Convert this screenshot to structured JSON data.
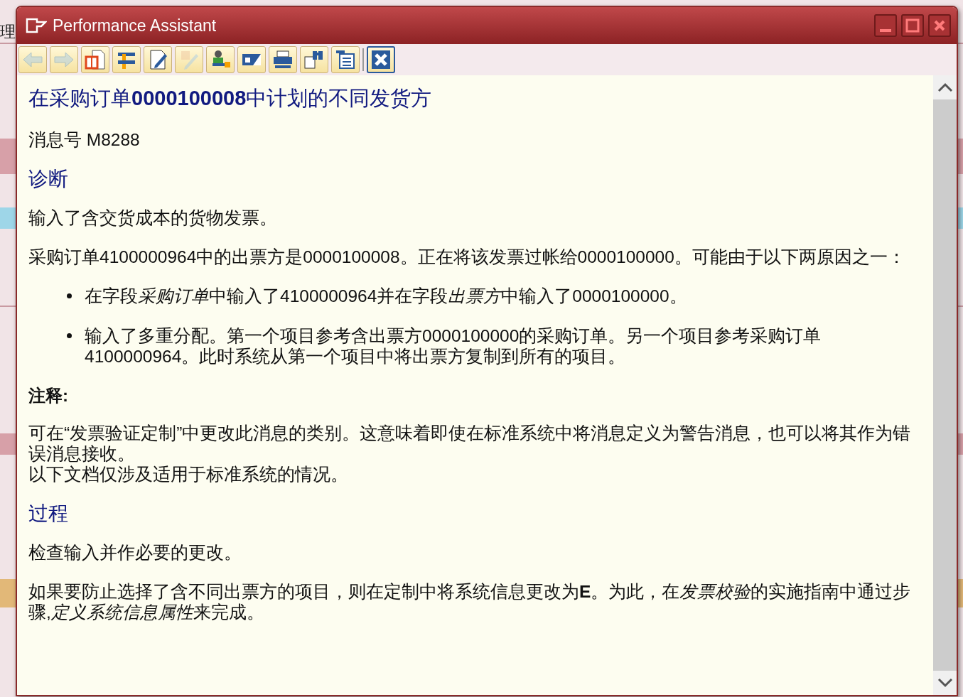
{
  "background": {
    "texts": [
      "理"
    ]
  },
  "window": {
    "title": "Performance Assistant"
  },
  "toolbar": [
    {
      "disabled": true
    },
    {
      "disabled": true
    },
    {
      "disabled": false
    },
    {
      "disabled": false
    },
    {
      "disabled": false
    },
    {
      "disabled": true
    },
    {
      "disabled": false
    },
    {
      "disabled": false
    },
    {
      "disabled": false
    },
    {
      "disabled": false
    },
    {
      "disabled": false
    },
    {
      "disabled": false
    }
  ],
  "document": {
    "title": "在采购订单**0000100008**中计划的不同发货方",
    "blocks": [
      {
        "kind": "paragraph",
        "lines": [
          "消息号 M8288"
        ]
      },
      {
        "kind": "heading",
        "text": "诊断"
      },
      {
        "kind": "paragraph",
        "lines": [
          "输入了含交货成本的货物发票。"
        ]
      },
      {
        "kind": "paragraph",
        "lines": [
          "采购订单4100000964中的出票方是0000100008。正在将该发票过帐给0000100000。可能由于以下两原因之一："
        ]
      },
      {
        "kind": "bullets",
        "items": [
          {
            "segments": [
              {
                "kind": "plain",
                "text": "在字段"
              },
              {
                "kind": "italic",
                "text": "采购订单"
              },
              {
                "kind": "plain",
                "text": "中输入了4100000964并在字段"
              },
              {
                "kind": "italic",
                "text": "出票方"
              },
              {
                "kind": "plain",
                "text": "中输入了0000100000。"
              }
            ]
          },
          {
            "segments": [
              {
                "kind": "plain",
                "text": "输入了多重分配。第一个项目参考含出票方0000100000的采购订单。另一个项目参考采购订单4100000964。此时系统从第一个项目中将出票方复制到所有的项目。"
              }
            ]
          }
        ]
      },
      {
        "kind": "note_heading",
        "text": "注释:"
      },
      {
        "kind": "paragraph",
        "lines": [
          "可在“发票验证定制”中更改此消息的类别。这意味着即使在标准系统中将消息定义为警告消息，也可以将其作为错误消息接收。",
          "以下文档仅涉及适用于标准系统的情况。"
        ]
      },
      {
        "kind": "heading",
        "text": "过程"
      },
      {
        "kind": "paragraph",
        "lines": [
          "检查输入并作必要的更改。"
        ]
      },
      {
        "kind": "rich_paragraph",
        "segments": [
          {
            "kind": "plain",
            "text": "如果要防止选择了含不同出票方的项目，则在定制中将系统信息更改为"
          },
          {
            "kind": "bold",
            "text": "E"
          },
          {
            "kind": "plain",
            "text": "。为此，在"
          },
          {
            "kind": "italic",
            "text": "发票校验"
          },
          {
            "kind": "plain",
            "text": "的实施指南中通过步骤,"
          },
          {
            "kind": "italic",
            "text": "定义系统信息属性"
          },
          {
            "kind": "plain",
            "text": "来完成。"
          }
        ]
      }
    ]
  }
}
